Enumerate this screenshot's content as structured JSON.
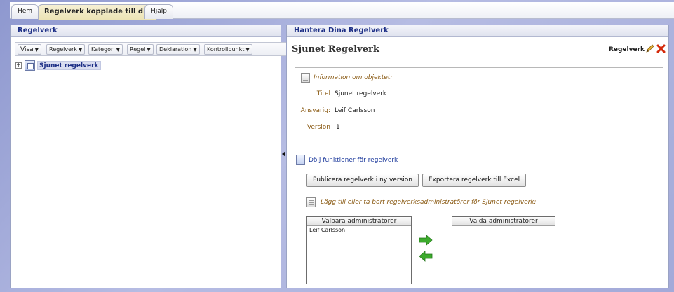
{
  "tabs": [
    {
      "label": "Hem",
      "active": false
    },
    {
      "label": "Regelverk kopplade till dig",
      "active": true
    },
    {
      "label": "Hjälp",
      "active": false
    }
  ],
  "left_panel": {
    "title": "Regelverk",
    "toolbar": [
      "Visa",
      "Regelverk",
      "Kategori",
      "Regel",
      "Deklaration",
      "Kontrollpunkt"
    ],
    "tree": {
      "toggle": "+",
      "label": "Sjunet regelverk"
    }
  },
  "right_panel": {
    "title": "Hantera Dina Regelverk",
    "object_title": "Sjunet Regelverk",
    "object_type": "Regelverk",
    "info_heading": "Information om objektet:",
    "fields": [
      {
        "label": "Titel",
        "value": "Sjunet regelverk"
      },
      {
        "label": "Ansvarig:",
        "value": "Leif Carlsson"
      },
      {
        "label": "Version",
        "value": "1"
      }
    ],
    "functions_link": "Dölj funktioner för regelverk",
    "publish_button": "Publicera regelverk i ny version",
    "export_button": "Exportera regelverk till Excel",
    "admin_heading": "Lägg till eller ta bort regelverksadministratörer för Sjunet regelverk:",
    "available": {
      "header": "Valbara administratörer",
      "items": [
        "Leif Carlsson"
      ]
    },
    "selected": {
      "header": "Valda administratörer",
      "items": []
    }
  },
  "colors": {
    "header_text": "#1d2f86",
    "label_brown": "#8a5a13",
    "arrow_green": "#3cab2c",
    "delete_red": "#d42a0b"
  }
}
